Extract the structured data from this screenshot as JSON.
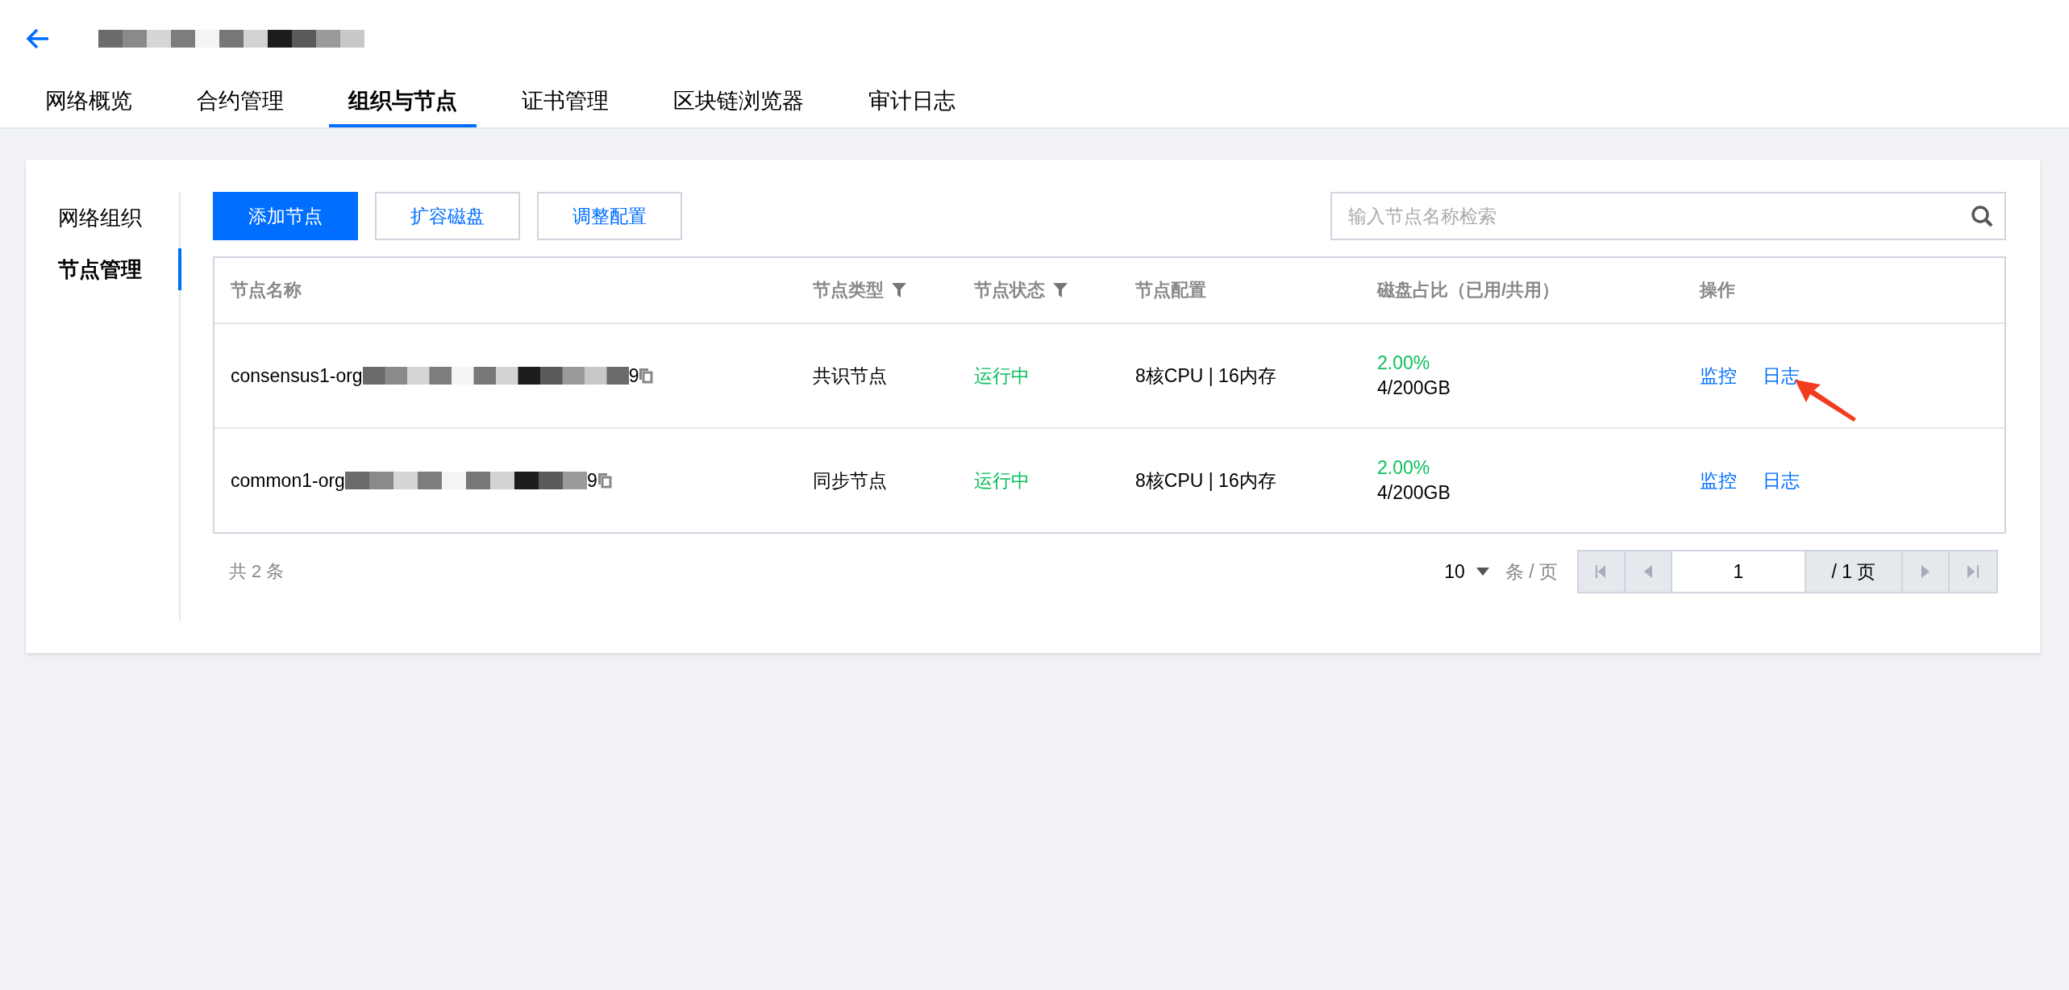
{
  "header": {
    "tabs": [
      {
        "label": "网络概览",
        "selected": false
      },
      {
        "label": "合约管理",
        "selected": false
      },
      {
        "label": "组织与节点",
        "selected": true
      },
      {
        "label": "证书管理",
        "selected": false
      },
      {
        "label": "区块链浏览器",
        "selected": false
      },
      {
        "label": "审计日志",
        "selected": false
      }
    ]
  },
  "sidebar": {
    "items": [
      {
        "label": "网络组织",
        "selected": false
      },
      {
        "label": "节点管理",
        "selected": true
      }
    ]
  },
  "toolbar": {
    "buttons": [
      {
        "label": "添加节点",
        "kind": "primary"
      },
      {
        "label": "扩容磁盘",
        "kind": "outline"
      },
      {
        "label": "调整配置",
        "kind": "outline"
      }
    ],
    "search": {
      "placeholder": "输入节点名称检索"
    }
  },
  "table": {
    "columns": [
      {
        "label": "节点名称",
        "filter": false
      },
      {
        "label": "节点类型",
        "filter": true
      },
      {
        "label": "节点状态",
        "filter": true
      },
      {
        "label": "节点配置",
        "filter": false
      },
      {
        "label": "磁盘占比（已用/共用）",
        "filter": false
      },
      {
        "label": "操作",
        "filter": false
      }
    ],
    "rows": [
      {
        "name_start": "consensus1-org",
        "name_end": "9",
        "type": "共识节点",
        "status": "运行中",
        "config": "8核CPU | 16内存",
        "disk_percent": "2.00%",
        "disk_usage": "4/200GB",
        "actions": [
          "监控",
          "日志"
        ],
        "annotated": true
      },
      {
        "name_start": "common1-org",
        "name_end": "9",
        "type": "同步节点",
        "status": "运行中",
        "config": "8核CPU | 16内存",
        "disk_percent": "2.00%",
        "disk_usage": "4/200GB",
        "actions": [
          "监控",
          "日志"
        ],
        "annotated": false
      }
    ]
  },
  "footer": {
    "total": "共 2 条",
    "page_size": "10",
    "page_size_unit": "条 / 页",
    "page": "1",
    "page_total": "/ 1 页"
  }
}
